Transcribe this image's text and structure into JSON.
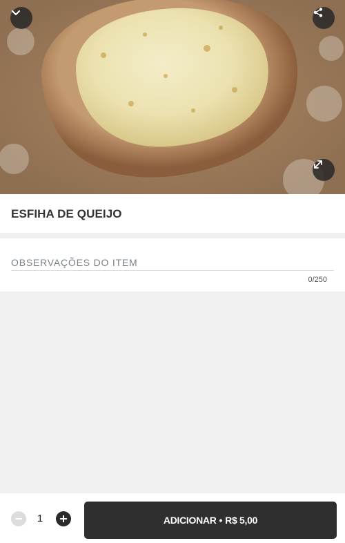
{
  "hero": {
    "collapse_icon": "chevron-down-icon",
    "share_icon": "share-icon",
    "expand_icon": "expand-icon"
  },
  "item": {
    "title": "ESFIHA DE QUEIJO"
  },
  "notes": {
    "placeholder": "OBSERVAÇÕES DO ITEM",
    "value": "",
    "char_count": "0/250"
  },
  "cart": {
    "quantity": "1",
    "add_label": "ADICIONAR",
    "separator": "•",
    "price": "R$ 5,00"
  },
  "colors": {
    "button_bg": "#2f2f2f",
    "page_bg": "#f0f0f0"
  }
}
